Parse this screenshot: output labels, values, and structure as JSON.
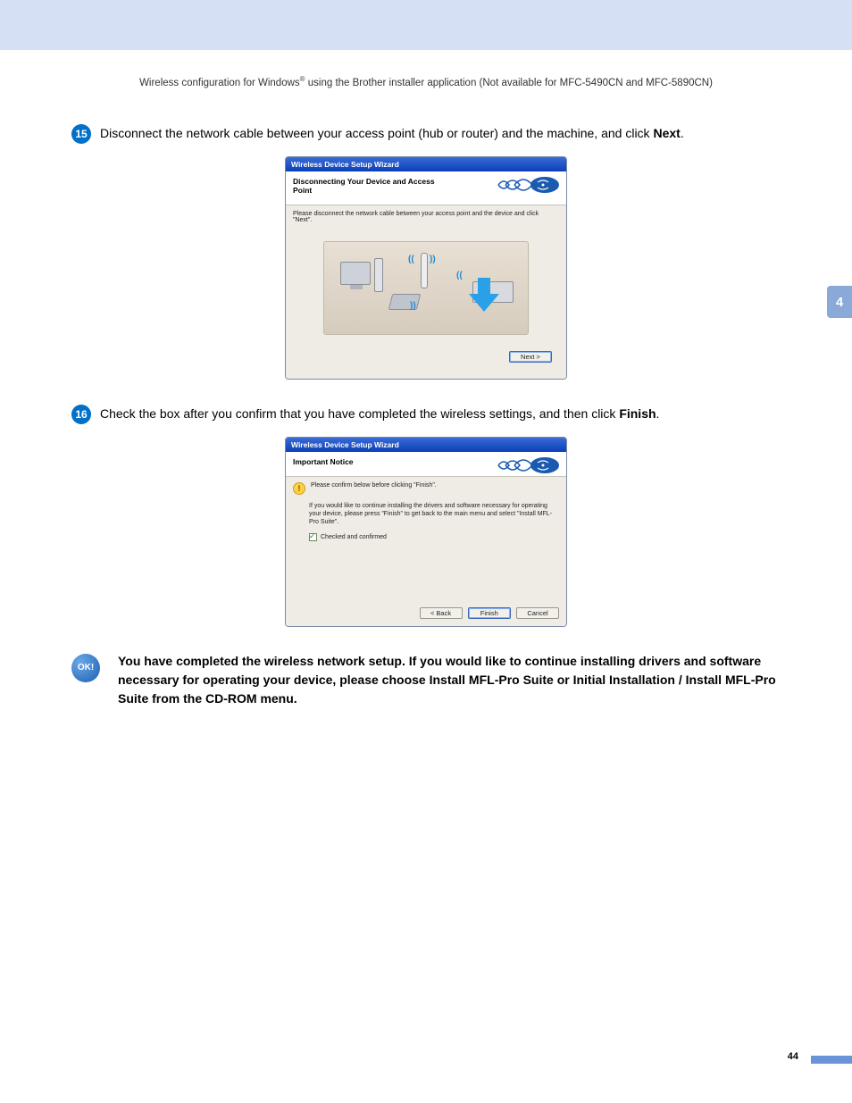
{
  "header": {
    "prefix": "Wireless configuration for Windows",
    "reg": "®",
    "suffix": " using the Brother installer application (Not available for MFC-5490CN and MFC-5890CN)"
  },
  "section_number": "4",
  "step15": {
    "num": "15",
    "text_a": "Disconnect the network cable between your access point (hub or router) and the machine, and click ",
    "text_b": "Next",
    "text_c": "."
  },
  "wizard1": {
    "titlebar": "Wireless Device Setup Wizard",
    "heading": "Disconnecting Your Device and Access Point",
    "instruction": "Please disconnect the network cable between your access point and the device and click \"Next\".",
    "next_btn": "Next >"
  },
  "step16": {
    "num": "16",
    "text_a": "Check the box after you confirm that you have completed the wireless settings, and then click ",
    "text_b": "Finish",
    "text_c": "."
  },
  "wizard2": {
    "titlebar": "Wireless Device Setup Wizard",
    "heading": "Important Notice",
    "confirm_line": "Please confirm below before clicking \"Finish\".",
    "body_text": "If you would like to continue installing the drivers and software necessary for operating your device, please press \"Finish\" to get back to the main menu and select \"Install MFL-Pro Suite\".",
    "checkbox_label": "Checked and confirmed",
    "back_btn": "< Back",
    "finish_btn": "Finish",
    "cancel_btn": "Cancel"
  },
  "ok": {
    "badge": "OK!",
    "text": "You have completed the wireless network setup. If you would like to continue installing drivers and software necessary for operating your device, please choose Install MFL-Pro Suite or Initial Installation / Install MFL-Pro Suite from the CD-ROM menu."
  },
  "page_number": "44"
}
